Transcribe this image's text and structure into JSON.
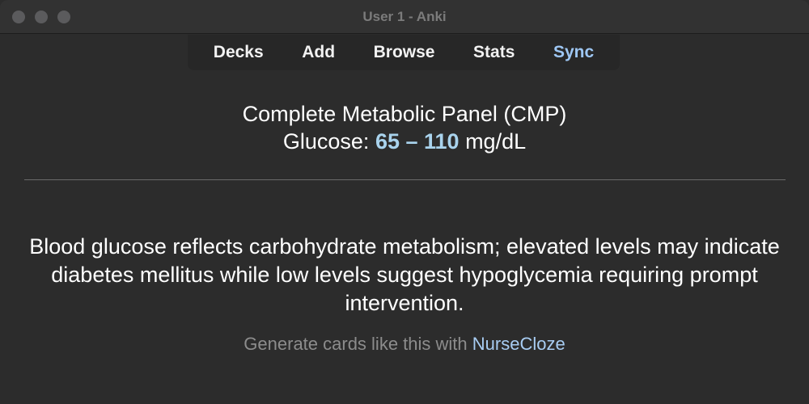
{
  "window": {
    "title": "User 1 - Anki"
  },
  "toolbar": {
    "decks": "Decks",
    "add": "Add",
    "browse": "Browse",
    "stats": "Stats",
    "sync": "Sync"
  },
  "card": {
    "front_line1": "Complete Metabolic Panel (CMP)",
    "front_label": "Glucose: ",
    "front_range": "65 – 110",
    "front_unit": " mg/dL",
    "back_text": "Blood glucose reflects carbohydrate metabolism; elevated levels may indicate diabetes mellitus while low levels suggest hypoglycemia requiring prompt intervention."
  },
  "promo": {
    "text": "Generate cards like this with ",
    "link": "NurseCloze"
  },
  "colors": {
    "background": "#2c2c2c",
    "highlight": "#a9d3ed",
    "link": "#a8cdf3",
    "sync": "#9ec7f4"
  }
}
